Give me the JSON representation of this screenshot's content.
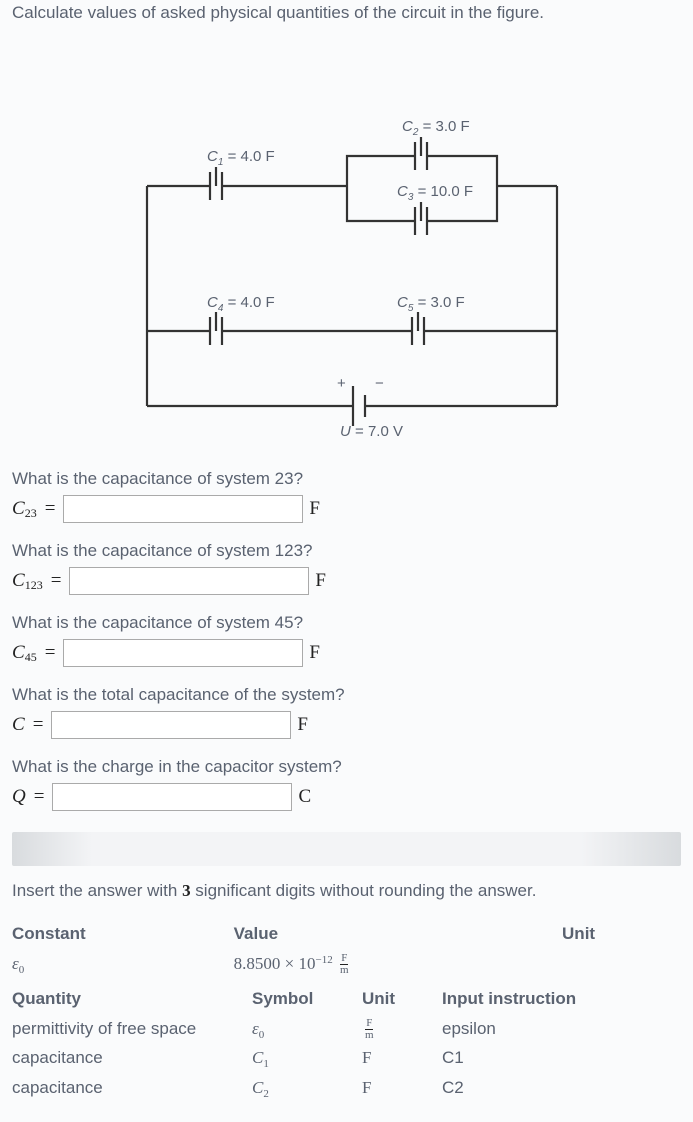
{
  "instruction": "Calculate values of asked physical quantities of the circuit in the figure.",
  "circuit": {
    "c1": {
      "name": "C",
      "sub": "1",
      "val": " = 4.0 F"
    },
    "c2": {
      "name": "C",
      "sub": "2",
      "val": " = 3.0 F"
    },
    "c3": {
      "name": "C",
      "sub": "3",
      "val": " = 10.0 F"
    },
    "c4": {
      "name": "C",
      "sub": "4",
      "val": " = 4.0 F"
    },
    "c5": {
      "name": "C",
      "sub": "5",
      "val": " = 3.0 F"
    },
    "u": {
      "name": "U",
      "val": " = 7.0 V"
    },
    "plus": "+",
    "minus": "−"
  },
  "questions": [
    {
      "prompt": "What is the capacitance of system 23?",
      "var": "C",
      "sub": "23",
      "unit": "F"
    },
    {
      "prompt": "What is the capacitance of system 123?",
      "var": "C",
      "sub": "123",
      "unit": "F"
    },
    {
      "prompt": "What is the capacitance of system 45?",
      "var": "C",
      "sub": "45",
      "unit": "F"
    },
    {
      "prompt": "What is the total capacitance of the system?",
      "var": "C",
      "sub": "",
      "unit": "F"
    },
    {
      "prompt": "What is the charge in the capacitor system?",
      "var": "Q",
      "sub": "",
      "unit": "C"
    }
  ],
  "sigdig": {
    "pre": "Insert the answer with ",
    "n": "3",
    "post": " significant digits without rounding the answer."
  },
  "const_table": {
    "headers": {
      "c0": "Constant",
      "c1": "Value",
      "c2": "Unit"
    },
    "row": {
      "sym": "ε",
      "sub": "0",
      "mant": "8.8500 × 10",
      "exp": "−12",
      "unit_num": "F",
      "unit_den": "m"
    }
  },
  "qty_table": {
    "headers": {
      "c0": "Quantity",
      "c1": "Symbol",
      "c2": "Unit",
      "c3": "Input instruction"
    },
    "rows": [
      {
        "q": "permittivity of free space",
        "sym": "ε",
        "sub": "0",
        "unit_num": "F",
        "unit_den": "m",
        "input": "epsilon"
      },
      {
        "q": "capacitance",
        "sym": "C",
        "sub": "1",
        "unit": "F",
        "input": "C1"
      },
      {
        "q": "capacitance",
        "sym": "C",
        "sub": "2",
        "unit": "F",
        "input": "C2"
      }
    ]
  }
}
